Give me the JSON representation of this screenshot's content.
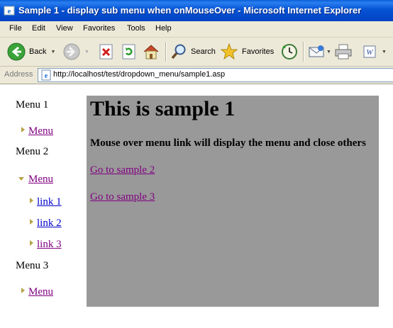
{
  "window": {
    "title": "Sample 1 - display sub menu when onMouseOver - Microsoft Internet Explorer"
  },
  "menubar": {
    "items": [
      {
        "label": "File"
      },
      {
        "label": "Edit"
      },
      {
        "label": "View"
      },
      {
        "label": "Favorites"
      },
      {
        "label": "Tools"
      },
      {
        "label": "Help"
      }
    ]
  },
  "toolbar": {
    "back_label": "Back",
    "search_label": "Search",
    "favorites_label": "Favorites"
  },
  "address": {
    "label": "Address",
    "url": "http://localhost/test/dropdown_menu/sample1.asp"
  },
  "sidebar": {
    "menu1": {
      "heading": "Menu 1",
      "link": "Menu"
    },
    "menu2": {
      "heading": "Menu 2",
      "link": "Menu",
      "sublinks": [
        "link 1",
        "link 2",
        "link 3"
      ]
    },
    "menu3": {
      "heading": "Menu 3",
      "link": "Menu"
    }
  },
  "main": {
    "heading": "This is sample 1",
    "description": "Mouse over menu link will display the menu and close others",
    "links": [
      "Go to sample 2",
      "Go to sample 3"
    ]
  },
  "colors": {
    "titlebar": "#0553d4",
    "chrome": "#ece9d8",
    "panel": "#999999",
    "visited_link": "#800080",
    "link": "#0000cc",
    "arrow": "#b8a24a"
  }
}
